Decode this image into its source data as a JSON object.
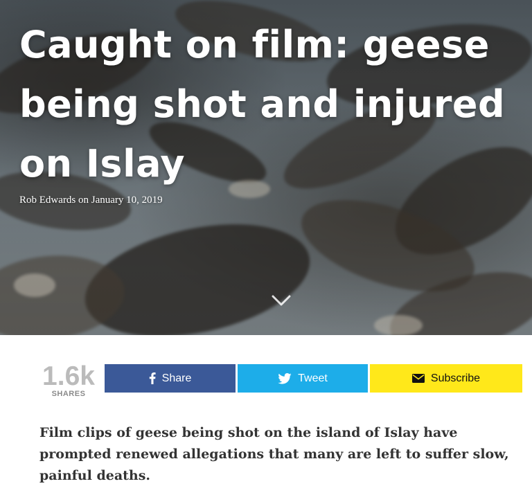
{
  "article": {
    "title": "Caught on film: geese being shot and injured on Islay",
    "byline": "Rob Edwards on January 10, 2019",
    "lede": "Film clips of geese being shot on the island of Islay have prompted renewed allegations that many are left to suffer slow, painful deaths."
  },
  "hero": {
    "scroll_icon": "chevron-down-icon",
    "image_subject": "flock of geese in flight"
  },
  "share": {
    "count": "1.6k",
    "count_label": "SHARES",
    "buttons": [
      {
        "label": "Share",
        "icon": "facebook-icon",
        "color": "#3b5998"
      },
      {
        "label": "Tweet",
        "icon": "twitter-icon",
        "color": "#1dade9"
      },
      {
        "label": "Subscribe",
        "icon": "envelope-icon",
        "color": "#ffe81a"
      }
    ]
  },
  "colors": {
    "text": "#333333",
    "count": "#bbbbbb"
  }
}
